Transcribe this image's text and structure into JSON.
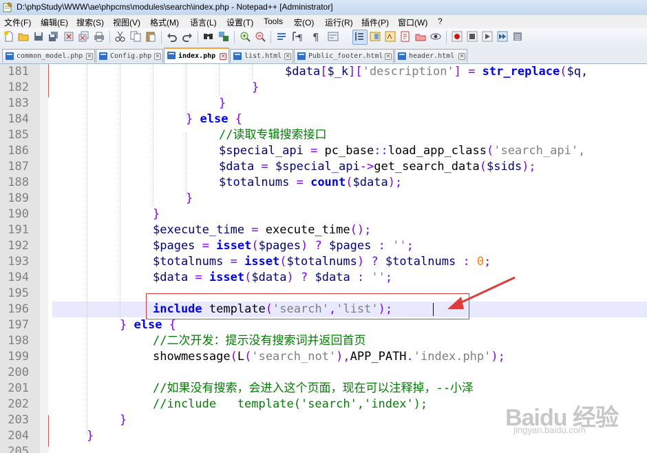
{
  "window": {
    "title": "D:\\phpStudy\\WWW\\ae\\phpcms\\modules\\search\\index.php - Notepad++ [Administrator]"
  },
  "menu": [
    "文件(F)",
    "编辑(E)",
    "搜索(S)",
    "视图(V)",
    "格式(M)",
    "语言(L)",
    "设置(T)",
    "Tools",
    "宏(O)",
    "运行(R)",
    "插件(P)",
    "窗口(W)",
    "?"
  ],
  "toolbar": {
    "icons": [
      "new-file-icon",
      "open-file-icon",
      "save-icon",
      "save-all-icon",
      "close-icon",
      "close-all-icon",
      "print-icon",
      "cut-icon",
      "copy-icon",
      "paste-icon",
      "undo-icon",
      "redo-icon",
      "find-icon",
      "replace-icon",
      "zoom-in-icon",
      "zoom-out-icon",
      "sync-scroll-icon",
      "word-wrap-icon",
      "show-all-chars-icon",
      "indent-guide-icon",
      "user-lang-icon",
      "doc-map-icon",
      "function-list-icon",
      "folder-as-workspace-icon",
      "monitor-icon",
      "record-macro-icon",
      "stop-record-icon",
      "play-macro-icon",
      "play-multiple-icon",
      "save-macro-icon"
    ]
  },
  "tabs": [
    {
      "label": "common_model.php",
      "active": false
    },
    {
      "label": "Config.php",
      "active": false
    },
    {
      "label": "index.php",
      "active": true
    },
    {
      "label": "list.html",
      "active": false
    },
    {
      "label": "Public_footer.html",
      "active": false
    },
    {
      "label": "header.html",
      "active": false
    }
  ],
  "editor": {
    "current_line": "196",
    "lines": [
      {
        "n": "181"
      },
      {
        "n": "182"
      },
      {
        "n": "183"
      },
      {
        "n": "184"
      },
      {
        "n": "185"
      },
      {
        "n": "186"
      },
      {
        "n": "187"
      },
      {
        "n": "188"
      },
      {
        "n": "189"
      },
      {
        "n": "190"
      },
      {
        "n": "191"
      },
      {
        "n": "192"
      },
      {
        "n": "193"
      },
      {
        "n": "194"
      },
      {
        "n": "195"
      },
      {
        "n": "196"
      },
      {
        "n": "197"
      },
      {
        "n": "198"
      },
      {
        "n": "199"
      },
      {
        "n": "200"
      },
      {
        "n": "201"
      },
      {
        "n": "202"
      },
      {
        "n": "203"
      },
      {
        "n": "204"
      },
      {
        "n": "205"
      }
    ]
  },
  "code": {
    "l181": [
      "$data",
      "[",
      "$_k",
      "][",
      "'description'",
      "]",
      " = ",
      "str_replace",
      "(",
      "$q,"
    ],
    "l182": "}",
    "l183": "}",
    "l184": [
      "}",
      " else ",
      "{"
    ],
    "l185": "//读取专辑搜索接口",
    "l186": [
      "$special_api",
      " = ",
      "pc_base",
      "::",
      "load_app_class",
      "(",
      "'search_api',"
    ],
    "l187": [
      "$data",
      " = ",
      "$special_api",
      "->",
      "get_search_data",
      "(",
      "$sids",
      ");"
    ],
    "l188": [
      "$totalnums",
      " = ",
      "count",
      "(",
      "$data",
      ");"
    ],
    "l189": "}",
    "l190": "}",
    "l191": [
      "$execute_time",
      " = ",
      "execute_time",
      "();"
    ],
    "l192": [
      "$pages",
      " = ",
      "isset",
      "(",
      "$pages",
      ")",
      " ? ",
      "$pages",
      " : ",
      "''",
      ";"
    ],
    "l193": [
      "$totalnums",
      " = ",
      "isset",
      "(",
      "$totalnums",
      ")",
      " ? ",
      "$totalnums",
      " : ",
      "0",
      ";"
    ],
    "l194": [
      "$data",
      " = ",
      "isset",
      "(",
      "$data",
      ")",
      " ? ",
      "$data",
      " : ",
      "''",
      ";"
    ],
    "l196": [
      "include",
      " ",
      "template",
      "(",
      "'search'",
      ",",
      "'list'",
      ");"
    ],
    "l197": [
      "}",
      " else ",
      "{"
    ],
    "l198": "//二次开发：提示没有搜索词并返回首页",
    "l199": [
      "showmessage",
      "(",
      "L",
      "(",
      "'search_not'",
      "),",
      "APP_PATH",
      ".",
      "'index.php'",
      ");"
    ],
    "l201": "//如果没有搜索，会进入这个页面，现在可以注释掉，--小泽",
    "l202": "//include   template('search','index');",
    "l203": "}",
    "l204": "}"
  },
  "watermark": {
    "logo": "Baidu 经验",
    "sub": "jingyan.baidu.com"
  },
  "colors": {
    "keyword": "#0000ff",
    "string": "#808080",
    "comment": "#008000",
    "operator": "#8000ff",
    "number": "#ff8000",
    "variable": "#000080",
    "annotation": "#e03b3b"
  }
}
